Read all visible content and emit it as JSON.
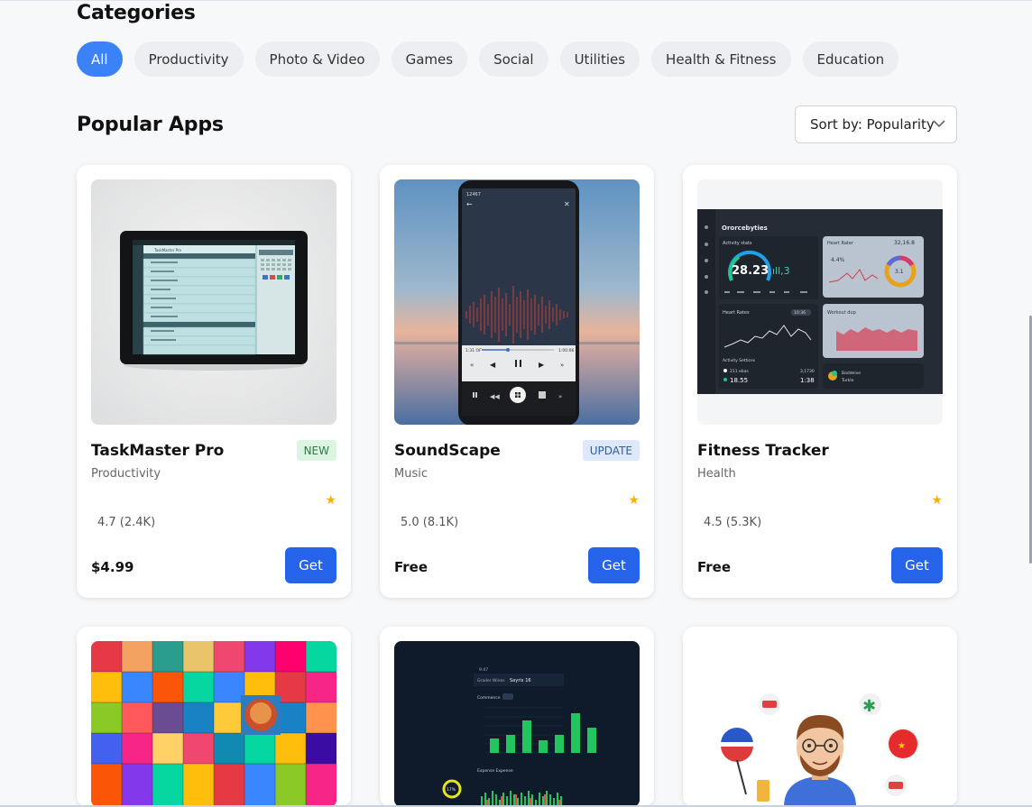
{
  "categories": {
    "title": "Categories",
    "chips": [
      "All",
      "Productivity",
      "Photo & Video",
      "Games",
      "Social",
      "Utilities",
      "Health & Fitness",
      "Education"
    ],
    "active": "All"
  },
  "popular": {
    "title": "Popular Apps",
    "sort_label": "Sort by: Popularity"
  },
  "apps": [
    {
      "name": "TaskMaster Pro",
      "category": "Productivity",
      "badge": "NEW",
      "rating": "4.7 (2.4K)",
      "price": "$4.99",
      "action": "Get",
      "icon": "star-icon"
    },
    {
      "name": "SoundScape",
      "category": "Music",
      "badge": "UPDATE",
      "rating": "5.0 (8.1K)",
      "price": "Free",
      "action": "Get",
      "icon": "star-icon"
    },
    {
      "name": "Fitness Tracker",
      "category": "Health",
      "badge": "",
      "rating": "4.5 (5.3K)",
      "price": "Free",
      "action": "Get",
      "icon": "star-icon"
    }
  ],
  "screenshots": {
    "fitness": {
      "brand": "Ororcebyties",
      "activity_title": "Activity stats",
      "activity_value": "28.23",
      "activity_secondary": "ıll,3",
      "heart_title": "Heart Rater",
      "heart_value": "32,16.8",
      "heart_pct": "4.4%",
      "heart_ring": "3.1",
      "rates_title": "Heart Rates",
      "rates_tag": "10:36",
      "workout_title": "Workout dup",
      "act_settings": "Activity Settices",
      "stat1_label": "211 ebas",
      "stat1_value": "3,1730",
      "stat2_value": "18.55",
      "stat2_right": "1:38",
      "legend_a": "Baddeive",
      "legend_b": "Turkle"
    },
    "music": {
      "time_left": "1:31 OF",
      "time_right": "1:00:06",
      "status_left": "12467"
    },
    "finance": {
      "header_left": "Grader Wines",
      "header_center": "Sayrix 16",
      "section": "Commence",
      "expense": "Expense Expense",
      "pct": "17%",
      "time": "9:47"
    },
    "tablet": {
      "app_title": "TaskMaster Pro"
    }
  },
  "colors": {
    "accent": "#3b82f6",
    "button": "#2563eb",
    "star": "#f5b400"
  }
}
